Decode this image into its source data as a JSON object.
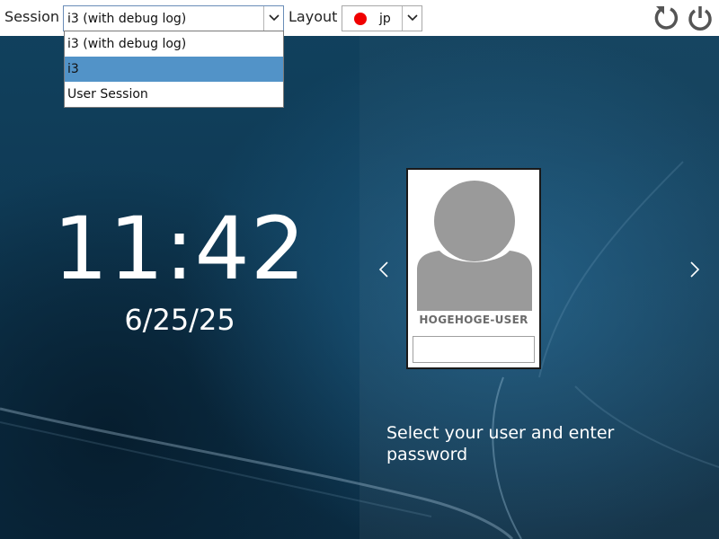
{
  "topbar": {
    "session_label": "Session",
    "session_value": "i3 (with debug log)",
    "layout_label": "Layout",
    "layout_value": "jp",
    "layout_flag_color": "#f00000",
    "icons": [
      "reboot-icon",
      "power-icon"
    ]
  },
  "session_dropdown": {
    "items": [
      {
        "label": "i3 (with debug log)",
        "selected": false
      },
      {
        "label": "i3",
        "selected": true
      },
      {
        "label": "User Session",
        "selected": false
      }
    ],
    "highlight_color": "#5293c8"
  },
  "clock": {
    "time": "11:42",
    "date": "6/25/25"
  },
  "user_card": {
    "username": "HOGEHOGE-USER",
    "password_value": "",
    "avatar_icon": "user-avatar-icon"
  },
  "prompt": "Select your user and enter password",
  "colors": {
    "background": "#0f3a55",
    "topbar": "#ffffff",
    "text_light": "#ffffff"
  }
}
